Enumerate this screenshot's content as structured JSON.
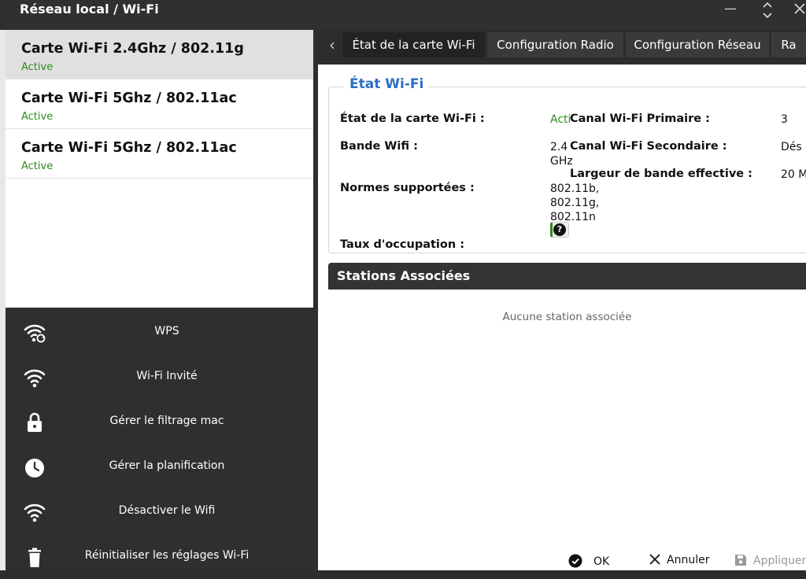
{
  "window": {
    "title": "Réseau local / Wi-Fi"
  },
  "cards": [
    {
      "name": "Carte Wi-Fi 2.4Ghz / 802.11g",
      "status": "Active"
    },
    {
      "name": "Carte Wi-Fi 5Ghz / 802.11ac",
      "status": "Active"
    },
    {
      "name": "Carte Wi-Fi 5Ghz / 802.11ac",
      "status": "Active"
    }
  ],
  "menu": [
    {
      "label": "WPS",
      "icon": "wifi-sync-icon"
    },
    {
      "label": "Wi-Fi Invité",
      "icon": "wifi-icon"
    },
    {
      "label": "Gérer le filtrage mac",
      "icon": "lock-icon"
    },
    {
      "label": "Gérer la planification",
      "icon": "clock-icon"
    },
    {
      "label": "Désactiver le Wifi",
      "icon": "wifi-icon"
    },
    {
      "label": "Réinitialiser les réglages Wi-Fi",
      "icon": "trash-icon"
    }
  ],
  "tabs": [
    "État de la carte Wi-Fi",
    "Configuration Radio",
    "Configuration Réseau",
    "Ra"
  ],
  "status": {
    "legend": "État Wi-Fi",
    "state_label": "État de la carte Wi-Fi :",
    "state_value": "Active",
    "band_label": "Bande Wifi :",
    "band_value_1": "2.4",
    "band_value_2": "GHz",
    "norms_label": "Normes supportées :",
    "norms_1": "802.11b,",
    "norms_2": "802.11g,",
    "norms_3": "802.11n",
    "occupation_label": "Taux d'occupation :",
    "occupation_help": "?",
    "primary_label": "Canal Wi-Fi Primaire :",
    "primary_value": "3",
    "secondary_label": "Canal Wi-Fi Secondaire :",
    "secondary_value": "Dés",
    "bandwidth_label": "Largeur de bande effective :",
    "bandwidth_value": "20 M"
  },
  "stations": {
    "title": "Stations Associées",
    "empty": "Aucune station associée"
  },
  "footer": {
    "ok": "OK",
    "cancel": "Annuler",
    "apply": "Appliquer"
  },
  "colors": {
    "active_green": "#2e8b1e",
    "legend_blue": "#2a6ec6",
    "dark_panel": "#2f2f2f"
  }
}
